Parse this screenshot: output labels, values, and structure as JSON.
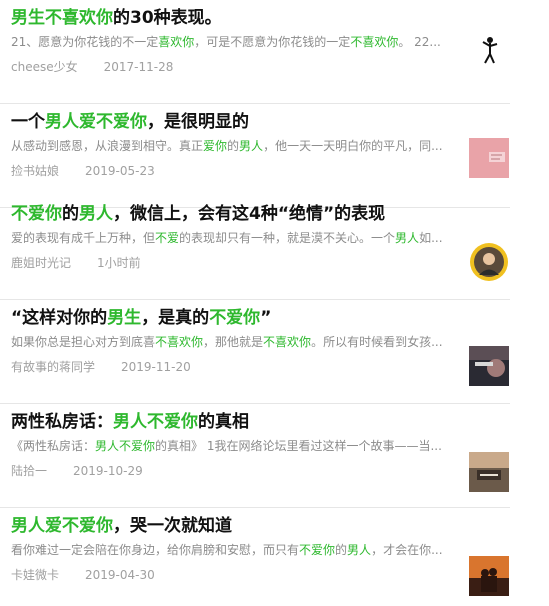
{
  "articles": [
    {
      "title_parts": [
        {
          "text": "男生",
          "hl": true
        },
        {
          "text": "不喜欢你",
          "hl": true
        },
        {
          "text": "的30种表现。",
          "hl": false
        }
      ],
      "snippet_parts": [
        {
          "text": "21、愿意为你花钱的不一定",
          "hl": false
        },
        {
          "text": "喜欢你",
          "hl": true
        },
        {
          "text": "，可是不愿意为你花钱的一定",
          "hl": false
        },
        {
          "text": "不喜欢你",
          "hl": true
        },
        {
          "text": "。 22...",
          "hl": false
        }
      ],
      "author": "cheese少女",
      "date": "2017-11-28",
      "thumb_icon": "stick-figure-thumbnail"
    },
    {
      "title_parts": [
        {
          "text": "一个",
          "hl": false
        },
        {
          "text": "男人爱不爱你",
          "hl": true
        },
        {
          "text": "，是很明显的",
          "hl": false
        }
      ],
      "snippet_parts": [
        {
          "text": "从感动到感恩，从浪漫到相守。真正",
          "hl": false
        },
        {
          "text": "爱你",
          "hl": true
        },
        {
          "text": "的",
          "hl": false
        },
        {
          "text": "男人",
          "hl": true
        },
        {
          "text": "，他一天一天明白你的平凡，同...",
          "hl": false
        }
      ],
      "author": "捡书姑娘",
      "date": "2019-05-23",
      "thumb_icon": "pink-card-thumbnail"
    },
    {
      "title_parts": [
        {
          "text": "不爱你",
          "hl": true
        },
        {
          "text": "的",
          "hl": false
        },
        {
          "text": "男人",
          "hl": true
        },
        {
          "text": "，微信上，会有这4种“绝情”的表现",
          "hl": false
        }
      ],
      "snippet_parts": [
        {
          "text": "爱的表现有成千上万种，但",
          "hl": false
        },
        {
          "text": "不爱",
          "hl": true
        },
        {
          "text": "的表现却只有一种，就是漠不关心。一个",
          "hl": false
        },
        {
          "text": "男人",
          "hl": true
        },
        {
          "text": "如...",
          "hl": false
        }
      ],
      "author": "鹿姐时光记",
      "date": "1小时前",
      "thumb_icon": "round-avatar-thumbnail"
    },
    {
      "title_parts": [
        {
          "text": "“这样对你的",
          "hl": false
        },
        {
          "text": "男生",
          "hl": true
        },
        {
          "text": "，是真的",
          "hl": false
        },
        {
          "text": "不爱你",
          "hl": true
        },
        {
          "text": "”",
          "hl": false
        }
      ],
      "snippet_parts": [
        {
          "text": "如果你总是担心对方到底喜",
          "hl": false
        },
        {
          "text": "不喜欢你",
          "hl": true
        },
        {
          "text": "，那他就是",
          "hl": false
        },
        {
          "text": "不喜欢你",
          "hl": true
        },
        {
          "text": "。所以有时候看到女孩...",
          "hl": false
        }
      ],
      "author": "有故事的蒋同学",
      "date": "2019-11-20",
      "thumb_icon": "dark-photo-thumbnail"
    },
    {
      "title_parts": [
        {
          "text": "两性私房话：",
          "hl": false
        },
        {
          "text": "男人不爱你",
          "hl": true
        },
        {
          "text": "的真相",
          "hl": false
        }
      ],
      "snippet_parts": [
        {
          "text": "《两性私房话：",
          "hl": false
        },
        {
          "text": "男人不爱你",
          "hl": true
        },
        {
          "text": "的真相》 1我在网络论坛里看过这样一个故事——当...",
          "hl": false
        }
      ],
      "author": "陆拾一",
      "date": "2019-10-29",
      "thumb_icon": "photo-label-thumbnail"
    },
    {
      "title_parts": [
        {
          "text": "男人爱不爱你",
          "hl": true
        },
        {
          "text": "，哭一次就知道",
          "hl": false
        }
      ],
      "snippet_parts": [
        {
          "text": "看你难过一定会陪在你身边，给你肩膀和安慰，而只有",
          "hl": false
        },
        {
          "text": "不爱你",
          "hl": true
        },
        {
          "text": "的",
          "hl": false
        },
        {
          "text": "男人",
          "hl": true
        },
        {
          "text": "，才会在你...",
          "hl": false
        }
      ],
      "author": "卡娃微卡",
      "date": "2019-04-30",
      "thumb_icon": "sunset-couple-thumbnail"
    }
  ],
  "colors": {
    "highlight": "#2eb82e",
    "title": "#111111",
    "snippet": "#8c8c8c",
    "meta": "#a0a0a0"
  }
}
